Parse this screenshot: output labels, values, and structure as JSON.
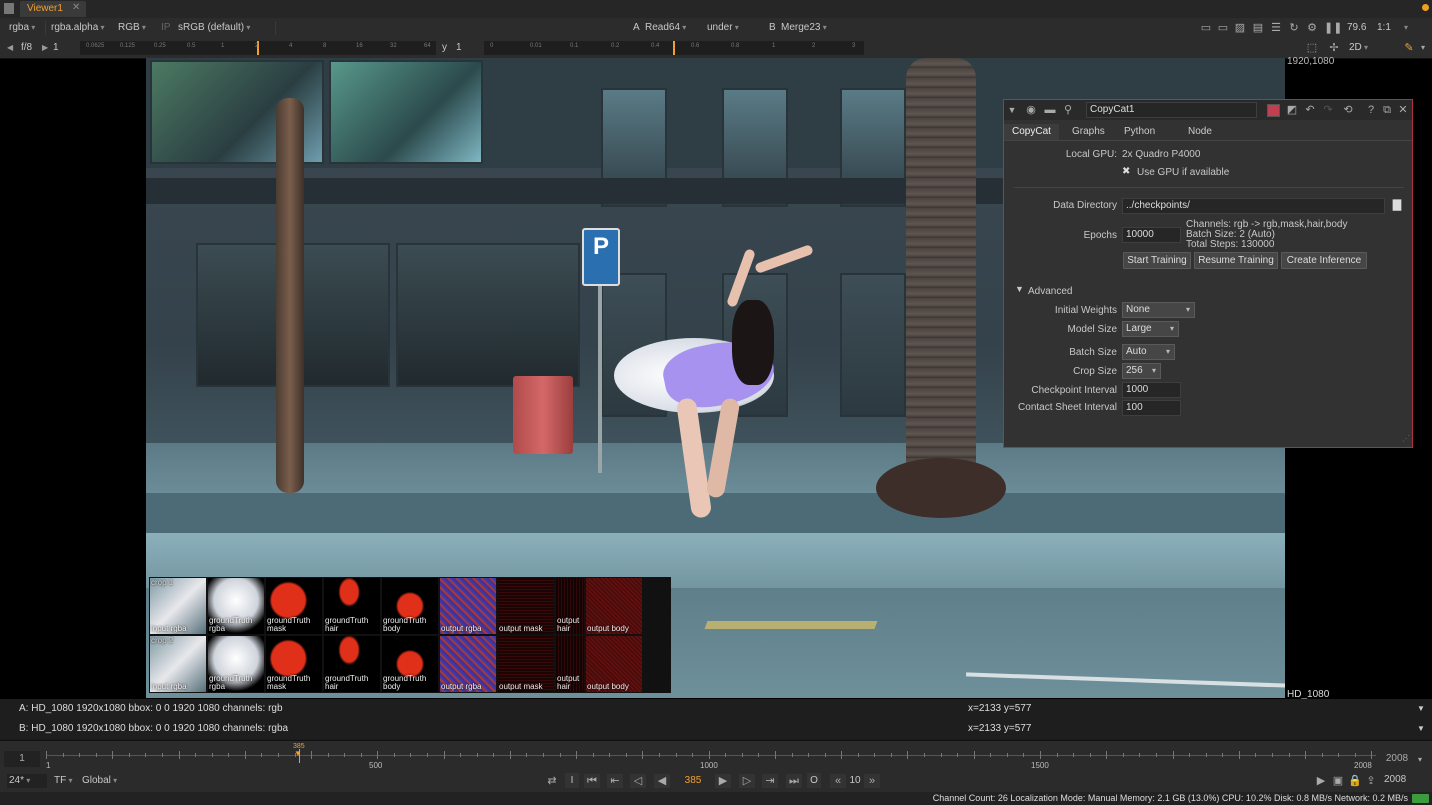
{
  "tab": {
    "title": "Viewer1"
  },
  "toolbar1": {
    "channels": "rgba",
    "alpha": "rgba.alpha",
    "display": "RGB",
    "ip": "IP",
    "colorspace": "sRGB (default)",
    "a_label": "A",
    "a_input": "Read64",
    "operation": "under",
    "b_label": "B",
    "b_input": "Merge23",
    "zoom": "79.6",
    "ratio": "1:1"
  },
  "toolbar2": {
    "fstop": "f/8",
    "gain": "1",
    "gain_ticks": [
      "0.0625",
      "0.125",
      "0.25",
      "0.5",
      "1",
      "2",
      "4",
      "8",
      "16",
      "32",
      "64"
    ],
    "gamma_label": "y",
    "gamma": "1",
    "gamma_ticks": [
      "0",
      "0.01",
      "0.1",
      "0.2",
      "0.4",
      "0.6",
      "0.8",
      "1",
      "2",
      "3"
    ],
    "view_mode": "2D"
  },
  "viewer": {
    "format_top": "1920,1080",
    "format_bottom": "HD_1080",
    "sign_letter": "P",
    "contact_sheet": [
      {
        "top": "crop 1",
        "labels": [
          "input rgba",
          "groundTruth rgba",
          "groundTruth mask",
          "groundTruth hair",
          "groundTruth body",
          "output rgba",
          "output mask",
          "output hair",
          "output body"
        ]
      },
      {
        "top": "crop 2",
        "labels": [
          "input rgba",
          "groundTruth rgba",
          "groundTruth mask",
          "groundTruth hair",
          "groundTruth body",
          "output rgba",
          "output mask",
          "output hair",
          "output body"
        ]
      }
    ]
  },
  "panel": {
    "node_name": "CopyCat1",
    "tabs": [
      "CopyCat",
      "Graphs",
      "Python",
      "Node"
    ],
    "local_gpu_label": "Local GPU:",
    "local_gpu_value": "2x Quadro P4000",
    "use_gpu": "Use GPU if available",
    "data_dir_label": "Data Directory",
    "data_dir_value": "../checkpoints/",
    "epochs_label": "Epochs",
    "epochs_value": "10000",
    "info_channels": "Channels: rgb -> rgb,mask,hair,body",
    "info_batch": "Batch Size: 2 (Auto)",
    "info_steps": "Total Steps: 130000",
    "btn_start": "Start Training",
    "btn_resume": "Resume Training",
    "btn_inference": "Create Inference",
    "advanced": "Advanced",
    "initial_weights_label": "Initial Weights",
    "initial_weights_value": "None",
    "model_size_label": "Model Size",
    "model_size_value": "Large",
    "batch_size_label": "Batch Size",
    "batch_size_value": "Auto",
    "crop_size_label": "Crop Size",
    "crop_size_value": "256",
    "checkpoint_label": "Checkpoint Interval",
    "checkpoint_value": "1000",
    "contact_label": "Contact Sheet Interval",
    "contact_value": "100"
  },
  "info": {
    "a_text": "A:  HD_1080 1920x1080  bbox: 0 0 1920 1080 channels: rgb",
    "a_coords": "x=2133 y=577",
    "b_text": "B:  HD_1080 1920x1080  bbox: 0 0 1920 1080 channels: rgba",
    "b_coords": "x=2133 y=577"
  },
  "timeline": {
    "start": "1",
    "end": "2008",
    "current": "385",
    "ticks": [
      "1",
      "500",
      "1000",
      "1500",
      "2008"
    ],
    "fps": "24*",
    "tf": "TF",
    "global": "Global",
    "frame": "385",
    "step": "10",
    "end_frame": "2008",
    "in_label": "I",
    "out_label": "O"
  },
  "status": {
    "text": "Channel Count: 26  Localization Mode: Manual  Memory: 2.1 GB (13.0%)  CPU: 10.2%  Disk: 0.8 MB/s  Network: 0.2 MB/s"
  }
}
